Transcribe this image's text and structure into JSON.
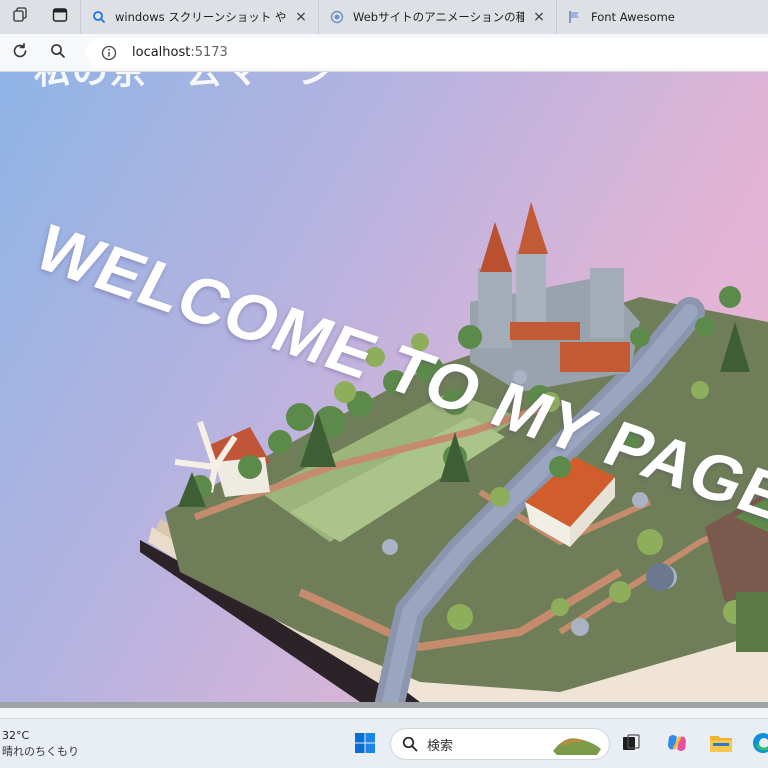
{
  "browser": {
    "tabs": [
      {
        "title": "windows スクリーンショット やり方 - I",
        "favicon": "search-favicon",
        "active": false
      },
      {
        "title": "Webサイトのアニメーションの種類と効",
        "favicon": "web-favicon",
        "active": false
      },
      {
        "title": "Font Awesome",
        "favicon": "flag-favicon",
        "active": false
      }
    ],
    "tab_close_glyph": "×",
    "address": {
      "host": "localhost",
      "port": ":5173"
    }
  },
  "page": {
    "clipped_heading": "私の京一去マーン",
    "welcome_text": "WELCOME TO MY PAGE"
  },
  "taskbar": {
    "weather_temp": "32°C",
    "weather_condition": "晴れのちくもり",
    "search_placeholder": "検索",
    "apps": [
      "windows-start-icon",
      "search-icon",
      "task-view-icon",
      "copilot-icon",
      "file-explorer-icon",
      "edge-icon"
    ],
    "accent": "#0078d4"
  }
}
